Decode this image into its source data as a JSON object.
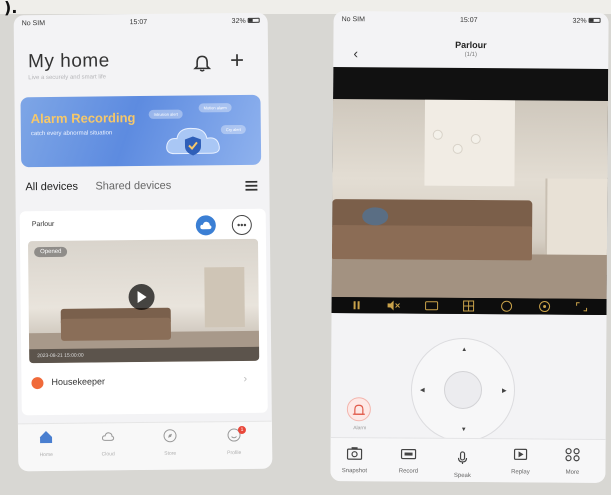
{
  "edge_glyph": ").",
  "phone_left": {
    "status": {
      "carrier": "No SIM",
      "time": "15:07",
      "battery": "32%"
    },
    "title": "My home",
    "subtitle": "Live a securely and smart life",
    "banner": {
      "title": "Alarm Recording",
      "subtitle": "catch every abnormal situation",
      "pills": [
        "Intrusion alert",
        "Motion alarm",
        "Cry alert"
      ]
    },
    "tabs": {
      "all": "All devices",
      "shared": "Shared devices"
    },
    "device": {
      "name": "Parlour",
      "status": "Opened",
      "timestamp": "2023-08-21 15:00:00"
    },
    "housekeeper": "Housekeeper",
    "nav": [
      {
        "label": "Home",
        "icon": "home-icon"
      },
      {
        "label": "Cloud",
        "icon": "cloud-icon"
      },
      {
        "label": "Store",
        "icon": "compass-icon"
      },
      {
        "label": "Profile",
        "icon": "profile-icon",
        "badge": "1"
      }
    ],
    "accent": "#3b7fd4"
  },
  "phone_right": {
    "status": {
      "carrier": "No SIM",
      "time": "15:07",
      "battery": "32%"
    },
    "title": "Parlour",
    "page": "(1/1)",
    "alarm_label": "Alarm",
    "toolbar": [
      {
        "label": "Snapshot",
        "icon": "camera-icon"
      },
      {
        "label": "Record",
        "icon": "video-icon"
      },
      {
        "label": "Speak",
        "icon": "microphone-icon"
      },
      {
        "label": "Replay",
        "icon": "replay-icon"
      },
      {
        "label": "More",
        "icon": "grid-icon"
      }
    ],
    "video_controls": [
      "pause-icon",
      "mute-icon",
      "sd-icon",
      "split-icon",
      "timer-icon",
      "settings-icon",
      "fullscreen-icon"
    ]
  }
}
